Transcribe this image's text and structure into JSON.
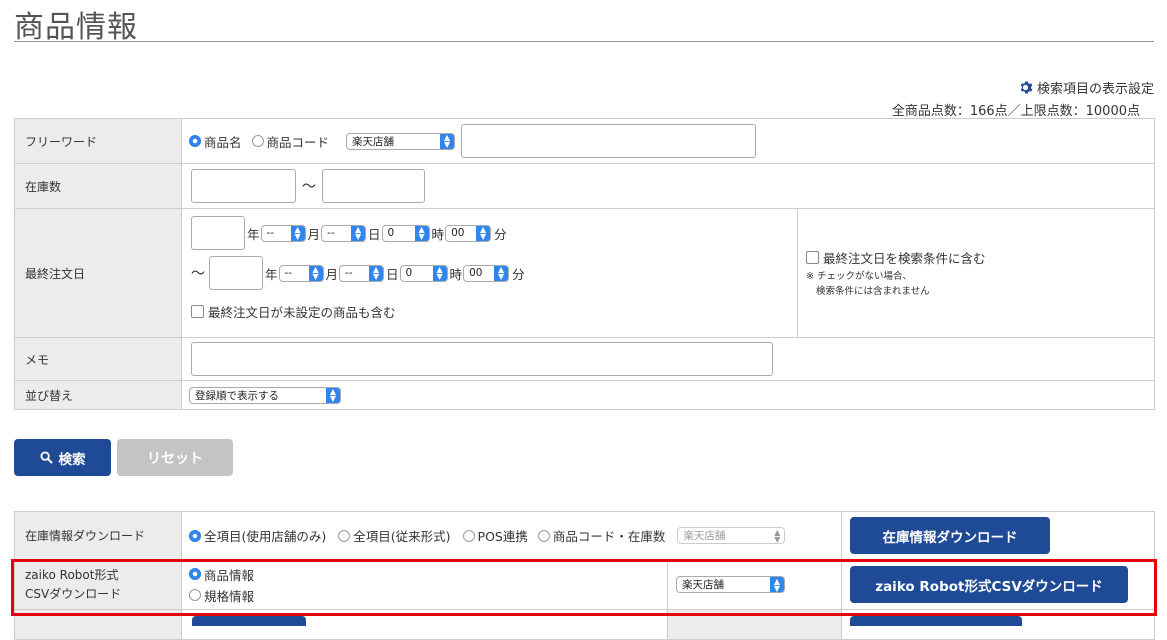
{
  "header": {
    "title": "商品情報",
    "settings_link": "検索項目の表示設定",
    "counts": "全商品点数：166点／上限点数：10000点"
  },
  "search": {
    "free_word": {
      "label": "フリーワード",
      "options": [
        "商品名",
        "商品コード"
      ],
      "selected": "商品名",
      "store": "楽天店舗",
      "value": ""
    },
    "stock": {
      "label": "在庫数",
      "tilde": "〜"
    },
    "last_order": {
      "label": "最終注文日",
      "year": "年",
      "month": "月",
      "day": "日",
      "hour": "時",
      "minute": "分",
      "tilde": "〜",
      "month_value": "--",
      "day_value": "--",
      "hour_value": "0",
      "minute_value": "00",
      "include_unset": "最終注文日が未設定の商品も含む",
      "include_condition": "最終注文日を検索条件に含む",
      "note1": "※ チェックがない場合、",
      "note2": "検索条件には含まれません"
    },
    "memo": {
      "label": "メモ"
    },
    "sort": {
      "label": "並び替え",
      "value": "登録順で表示する"
    },
    "search_button": "検索",
    "reset_button": "リセット"
  },
  "download": {
    "stock_row": {
      "label": "在庫情報ダウンロード",
      "options": [
        "全項目(使用店舗のみ)",
        "全項目(従来形式)",
        "POS連携",
        "商品コード・在庫数"
      ],
      "selected": "全項目(使用店舗のみ)",
      "store": "楽天店舗",
      "button": "在庫情報ダウンロード"
    },
    "zaiko_row": {
      "label_line1": "zaiko Robot形式",
      "label_line2": "CSVダウンロード",
      "options": [
        "商品情報",
        "規格情報"
      ],
      "selected": "商品情報",
      "store": "楽天店舗",
      "button": "zaiko Robot形式CSVダウンロード"
    }
  },
  "colors": {
    "primary": "#1e4a96",
    "highlight": "#e8000f",
    "radio_on": "#2f86ee"
  }
}
